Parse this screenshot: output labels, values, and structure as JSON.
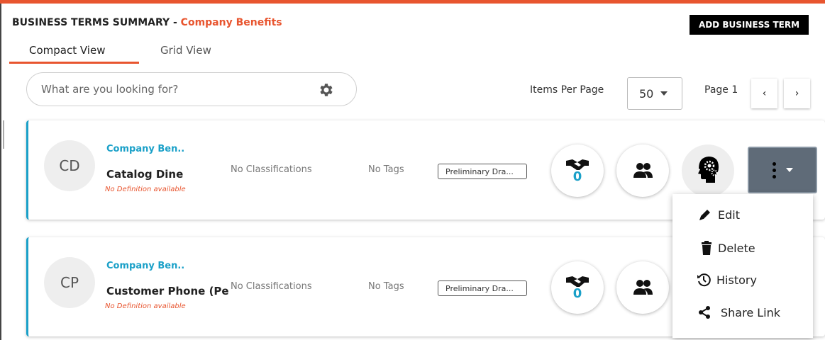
{
  "header": {
    "title_prefix": "BUSINESS TERMS SUMMARY",
    "title_separator": " - ",
    "title_glossary": "Company Benefits",
    "add_button": "ADD BUSINESS TERM"
  },
  "tabs": [
    {
      "label": "Compact View",
      "active": true
    },
    {
      "label": "Grid View",
      "active": false
    }
  ],
  "search": {
    "placeholder": "What are you looking for?",
    "icon": "gear-icon"
  },
  "pagination": {
    "items_per_page_label": "Items Per Page",
    "items_per_page_value": "50",
    "page_label": "Page 1",
    "prev": "‹",
    "next": "›"
  },
  "terms": [
    {
      "initials": "CD",
      "glossary": "Company Ben..",
      "name": "Catalog Dine",
      "definition": "No Definition available",
      "classifications": "No Classifications",
      "tags": "No Tags",
      "status": "Preliminary Dra...",
      "approvals_count": "0"
    },
    {
      "initials": "CP",
      "glossary": "Company Ben..",
      "name": "Customer Phone (Pe",
      "definition": "No Definition available",
      "classifications": "No Classifications",
      "tags": "No Tags",
      "status": "Preliminary Dra...",
      "approvals_count": "0"
    }
  ],
  "action_menu": {
    "items": [
      {
        "label": "Edit",
        "icon": "pencil-icon"
      },
      {
        "label": "Delete",
        "icon": "trash-icon"
      },
      {
        "label": "History",
        "icon": "history-icon"
      },
      {
        "label": "Share Link",
        "icon": "share-icon"
      }
    ]
  },
  "colors": {
    "accent": "#e8552f",
    "link": "#1aa0c8",
    "button": "#000000",
    "more_button": "#5f6b78"
  }
}
